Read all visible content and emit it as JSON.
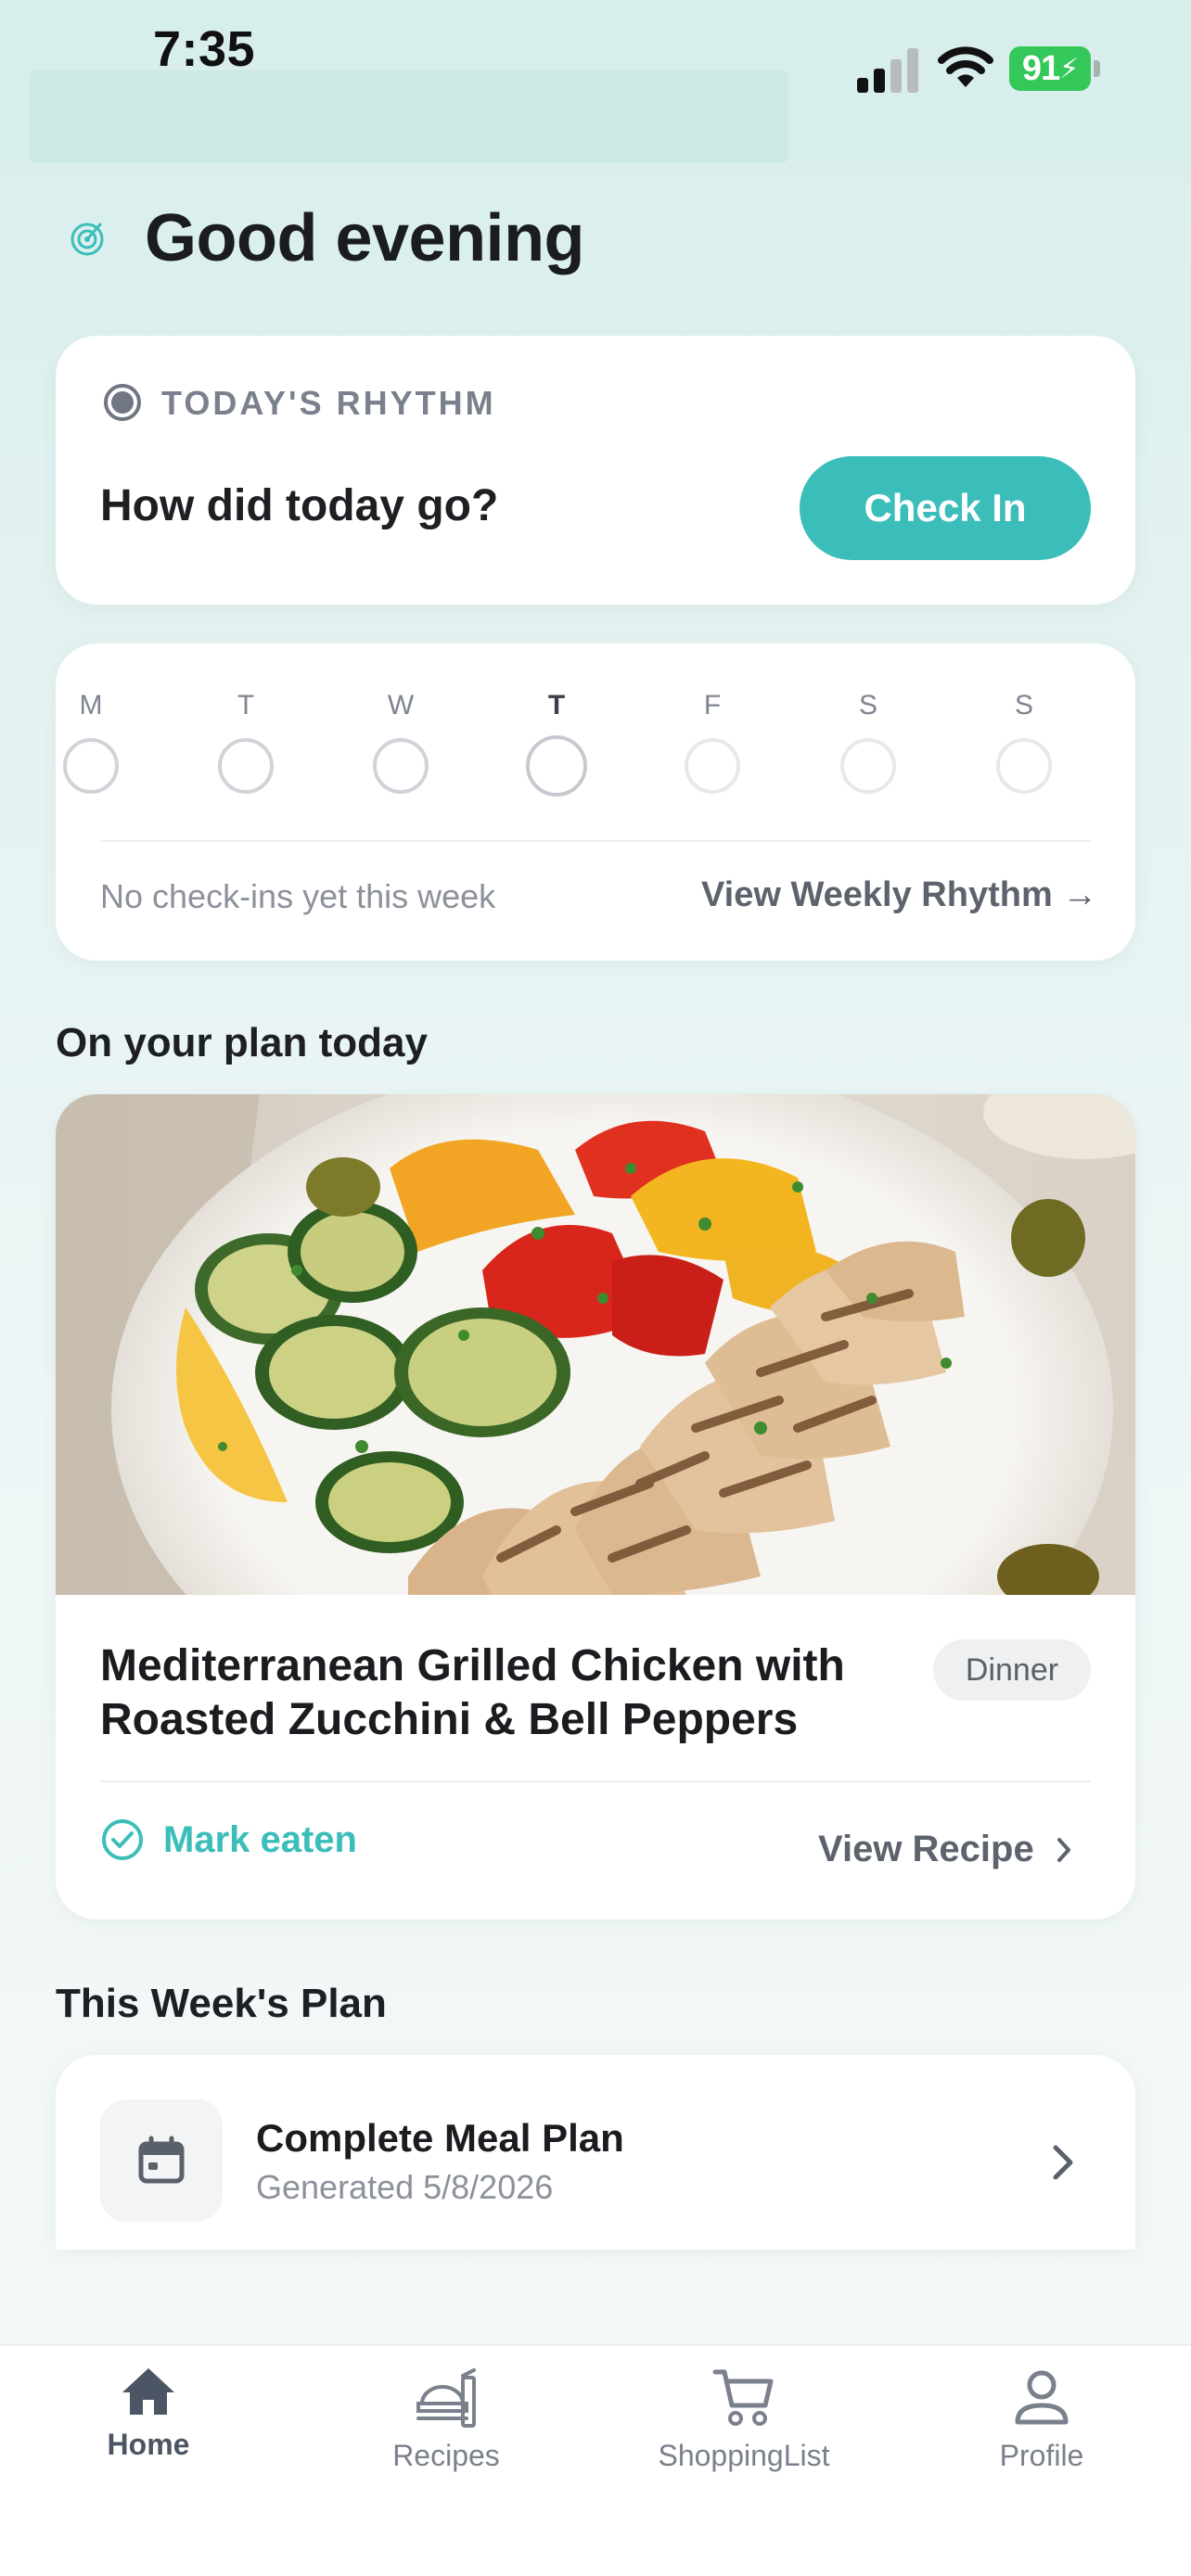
{
  "status_bar": {
    "time": "7:35",
    "battery": "91"
  },
  "greeting": "Good evening",
  "rhythm": {
    "label": "TODAY'S RHYTHM",
    "question": "How did today go?",
    "checkin_button": "Check In"
  },
  "week": {
    "days": [
      "M",
      "T",
      "W",
      "T",
      "F",
      "S",
      "S"
    ],
    "today_index": 3,
    "empty_text": "No check-ins yet this week",
    "link": "View Weekly Rhythm →"
  },
  "plan_today": {
    "title": "On your plan today",
    "meal": {
      "name": "Mediterranean Grilled Chicken with Roasted Zucchini & Bell Peppers",
      "badge": "Dinner",
      "mark_eaten": "Mark eaten",
      "view_recipe": "View Recipe"
    }
  },
  "week_plan": {
    "title": "This Week's Plan",
    "item": {
      "name": "Complete Meal Plan",
      "subtitle": "Generated 5/8/2026"
    }
  },
  "tabs": [
    {
      "label": "Home",
      "icon": "home-icon",
      "active": true
    },
    {
      "label": "Recipes",
      "icon": "recipes-icon",
      "active": false
    },
    {
      "label": "ShoppingList",
      "icon": "cart-icon",
      "active": false
    },
    {
      "label": "Profile",
      "icon": "profile-icon",
      "active": false
    }
  ],
  "colors": {
    "accent": "#3bbdba",
    "battery": "#34c759",
    "text": "#1d1f22",
    "muted": "#8c919b"
  }
}
